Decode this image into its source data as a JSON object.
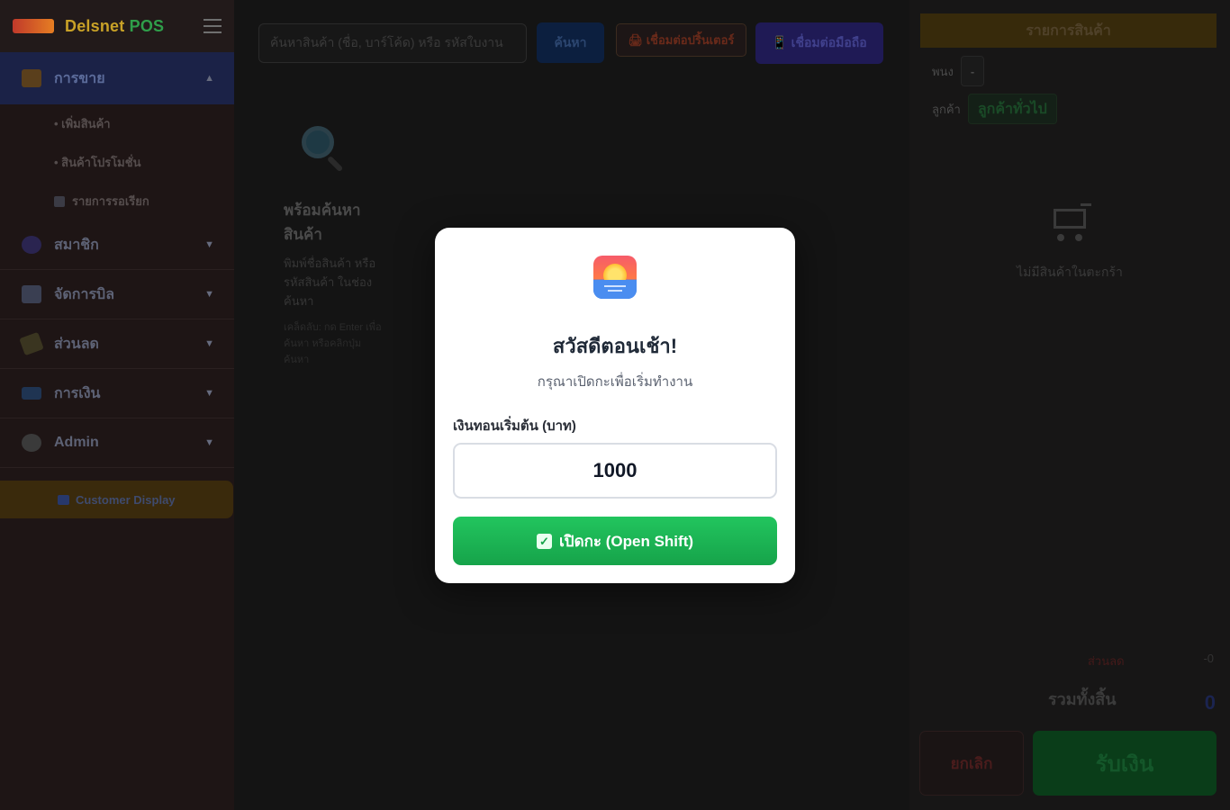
{
  "sidebar": {
    "brand_prefix": "Delsnet",
    "brand_suffix": "POS",
    "menu": [
      {
        "label": "การขาย",
        "caret": "▲"
      },
      {
        "label": "สมาชิก",
        "caret": "▼"
      },
      {
        "label": "จัดการบิล",
        "caret": "▼"
      },
      {
        "label": "ส่วนลด",
        "caret": "▼"
      },
      {
        "label": "การเงิน",
        "caret": "▼"
      },
      {
        "label": "Admin",
        "caret": "▼"
      }
    ],
    "sales_sub": [
      {
        "label": "• เพิ่มสินค้า"
      },
      {
        "label": "• สินค้าโปรโมชั่น"
      },
      {
        "label": "รายการรอเรียก"
      }
    ],
    "customer_display": "Customer Display"
  },
  "toolbar": {
    "search_placeholder": "ค้นหาสินค้า (ชื่อ, บาร์โค้ด) หรือ รหัสใบงาน",
    "search_button": "ค้นหา",
    "printer_button": "🖨 เชื่อมต่อปริ้นเตอร์",
    "mobile_button": "📱 เชื่อมต่อมือถือ"
  },
  "ready": {
    "title": "พร้อมค้นหาสินค้า",
    "desc": "พิมพ์ชื่อสินค้า หรือรหัสสินค้า ในช่องค้นหา",
    "hint": "เคล็ดลับ: กด Enter เพื่อค้นหา หรือคลิกปุ่มค้นหา"
  },
  "cart": {
    "title": "รายการสินค้า",
    "staff_label": "พนง",
    "staff_value": "-",
    "customer_label": "ลูกค้า",
    "customer_value": "ลูกค้าทั่วไป",
    "empty_text": "ไม่มีสินค้าในตะกร้า",
    "discount_label": "ส่วนลด",
    "discount_value": "-0",
    "total_label": "รวมทั้งสิ้น",
    "total_value": "0",
    "cancel_button": "ยกเลิก",
    "pay_button": "รับเงิน"
  },
  "modal": {
    "title": "สวัสดีตอนเช้า!",
    "subtitle": "กรุณาเปิดกะเพื่อเริ่มทำงาน",
    "field_label": "เงินทอนเริ่มต้น (บาท)",
    "field_value": "1000",
    "submit_label": "เปิดกะ (Open Shift)",
    "submit_icon": "✓"
  },
  "colors": {
    "overlay": "#000000",
    "success": "#22c55e",
    "brand_gold": "#c9a227",
    "brand_green": "#2f9e4a"
  }
}
